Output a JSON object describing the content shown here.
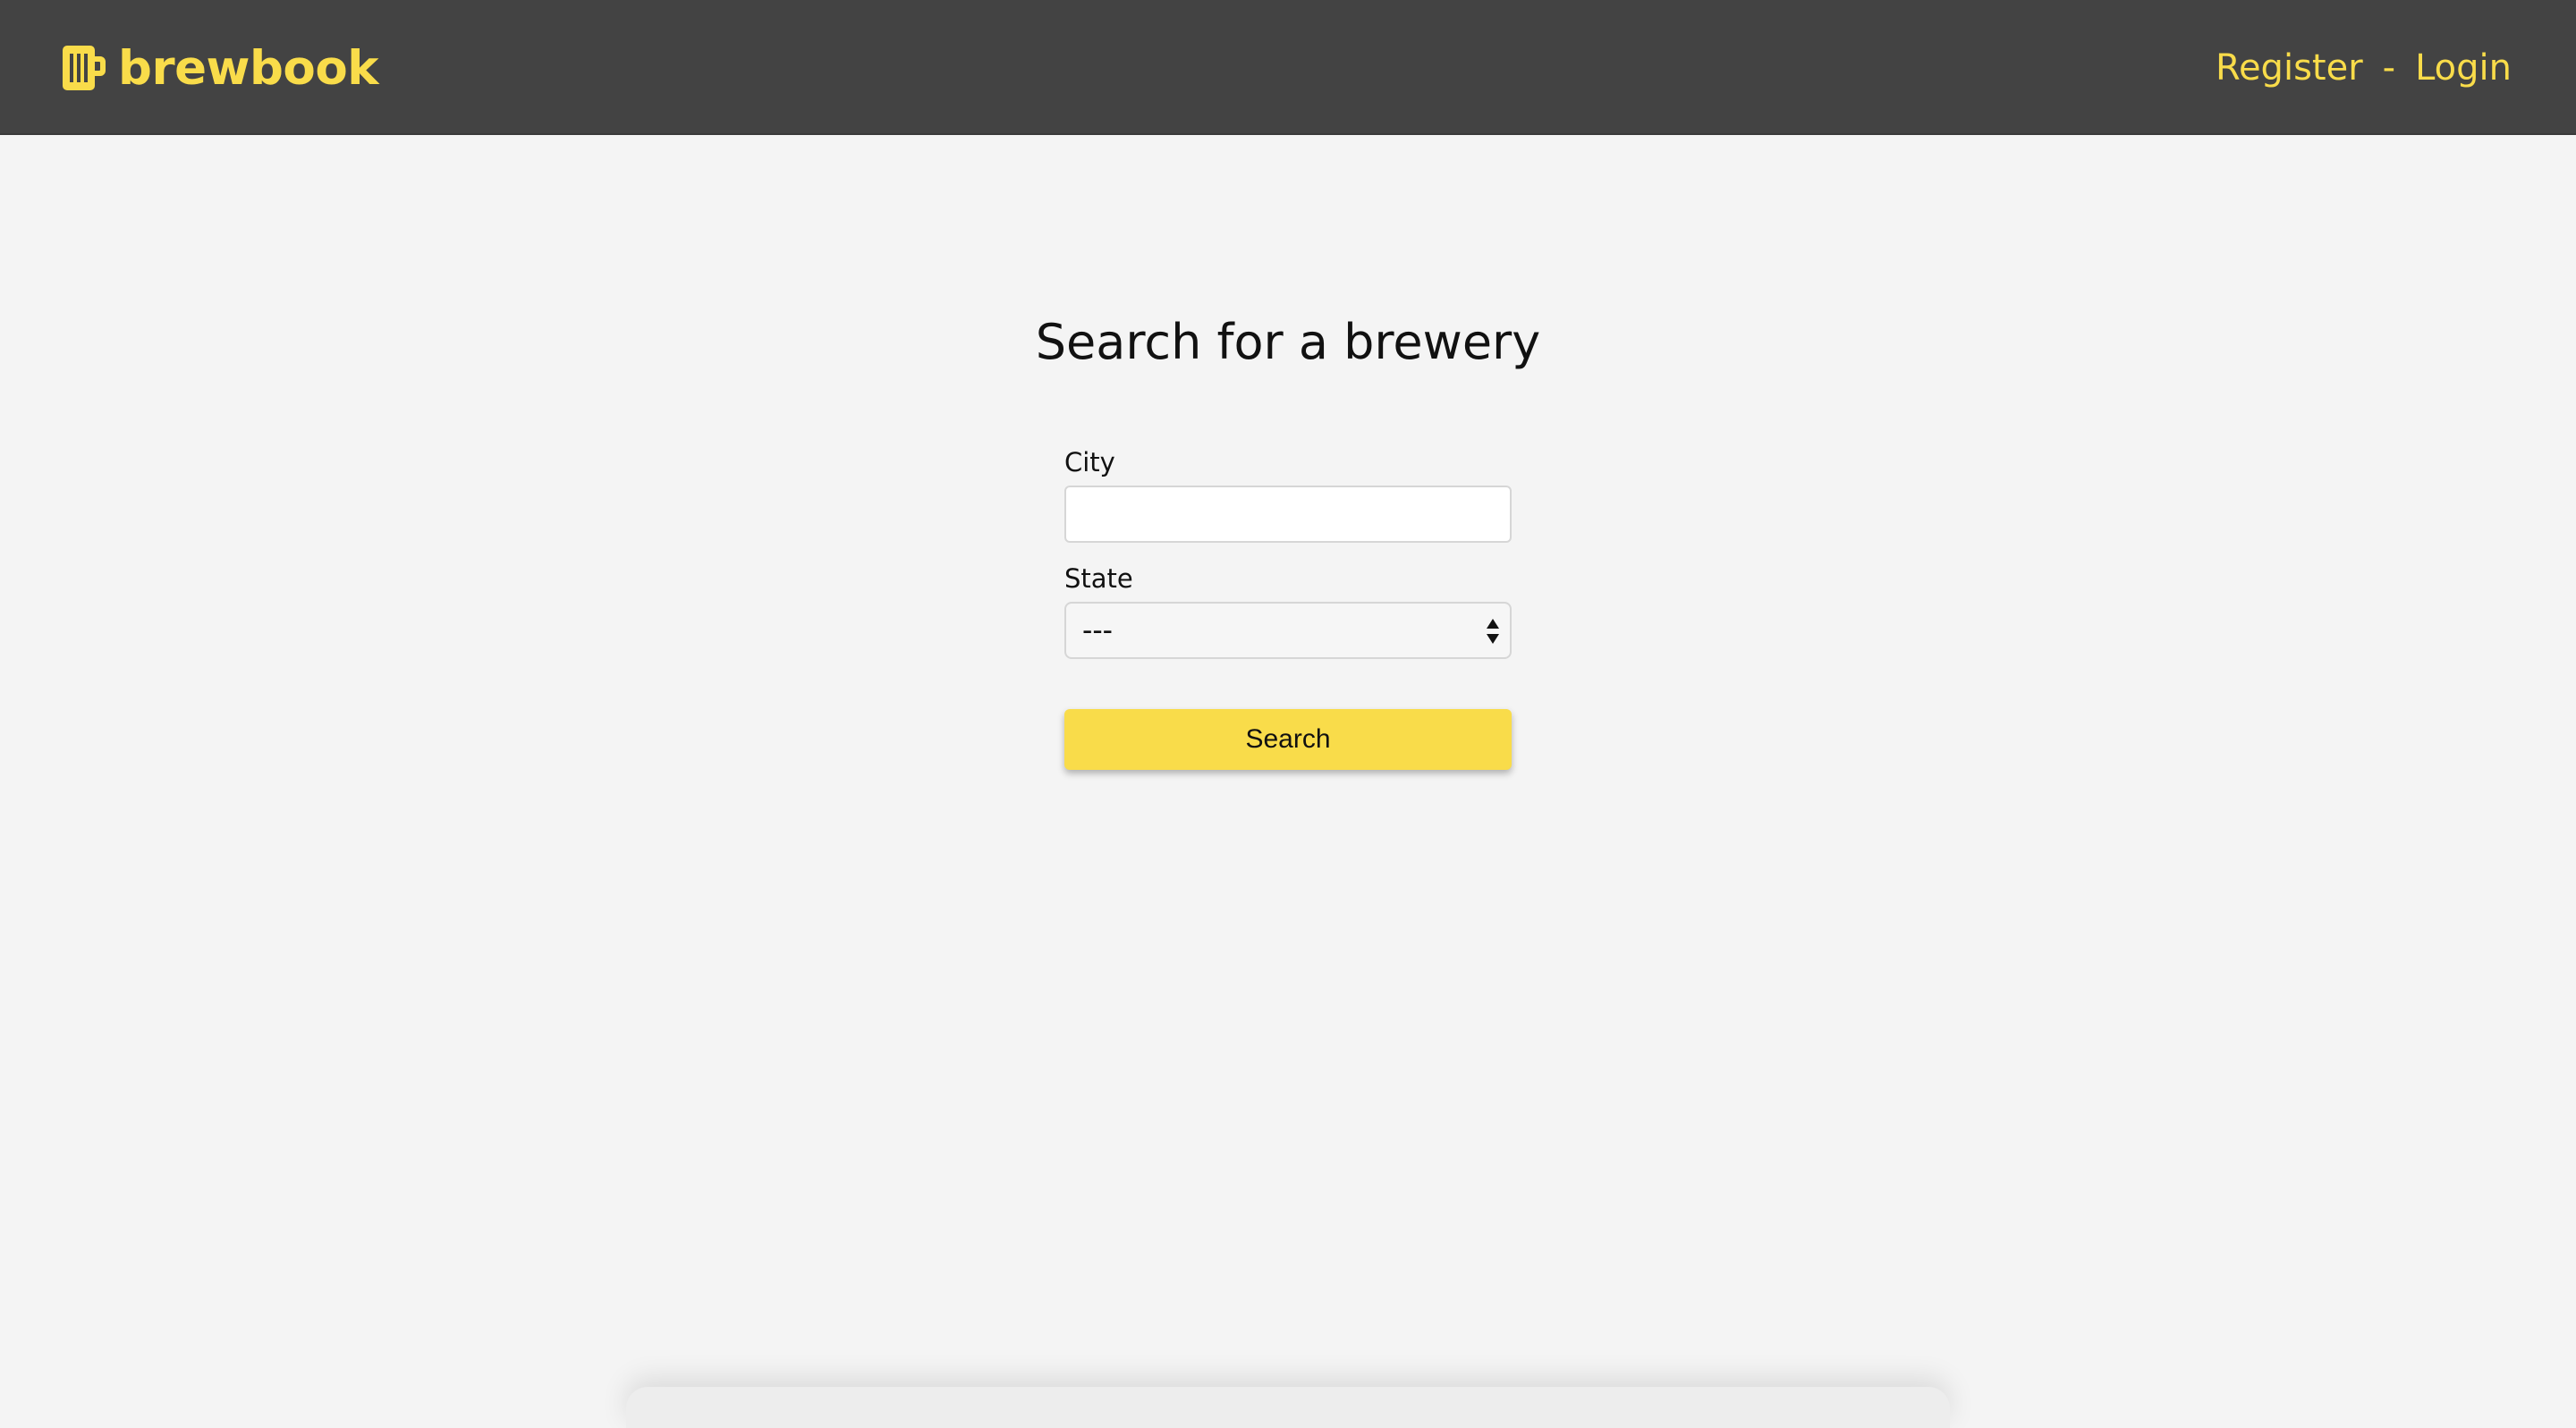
{
  "header": {
    "brand": "brewbook",
    "brand_icon": "beer-mug-icon",
    "register_label": "Register",
    "separator": "-",
    "login_label": "Login",
    "accent_color": "#f9dc4a",
    "bar_color": "#434343"
  },
  "main": {
    "title": "Search for a brewery",
    "city_label": "City",
    "city_value": "",
    "state_label": "State",
    "state_value": "---",
    "search_label": "Search"
  }
}
